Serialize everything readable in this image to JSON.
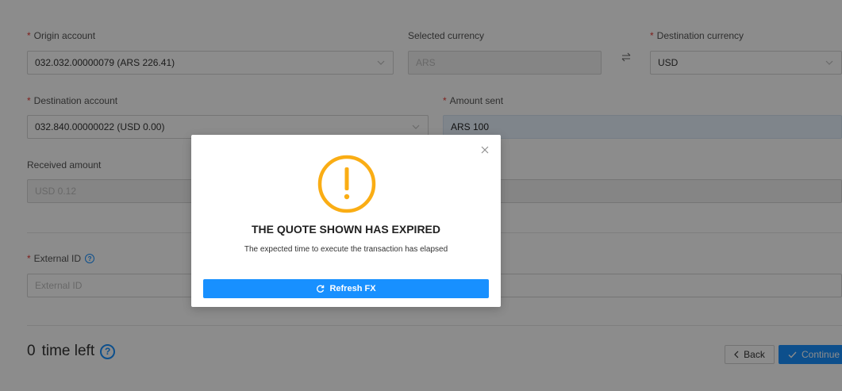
{
  "form": {
    "origin_account": {
      "label": "Origin account",
      "value": "032.032.00000079 (ARS 226.41)"
    },
    "selected_currency": {
      "label": "Selected currency",
      "value": "ARS"
    },
    "destination_currency": {
      "label": "Destination currency",
      "value": "USD"
    },
    "destination_account": {
      "label": "Destination account",
      "value": "032.840.00000022 (USD 0.00)"
    },
    "amount_sent": {
      "label": "Amount sent",
      "value": "ARS 100"
    },
    "received_amount": {
      "label": "Received amount",
      "value": "USD 0.12"
    },
    "external_id": {
      "label": "External ID",
      "placeholder": "External ID"
    },
    "required_marker": "*"
  },
  "footer": {
    "timer_value": "0",
    "timer_label": "time left",
    "help_glyph": "?",
    "back_label": "Back",
    "continue_label": "Continue"
  },
  "modal": {
    "title": "THE QUOTE SHOWN HAS EXPIRED",
    "message": "The expected time to execute the transaction has elapsed",
    "button_label": "Refresh FX",
    "warning_glyph": "!"
  },
  "icons": {
    "swap": "swap-icon",
    "chevron": "chevron-down-icon",
    "close": "close-icon",
    "refresh": "refresh-icon",
    "warning": "warning-icon",
    "back": "chevron-left-icon",
    "check": "check-icon",
    "help": "help-icon"
  },
  "colors": {
    "primary": "#1890ff",
    "warning": "#faad14",
    "required": "#e53935",
    "highlight_field": "#e8f2fe"
  }
}
